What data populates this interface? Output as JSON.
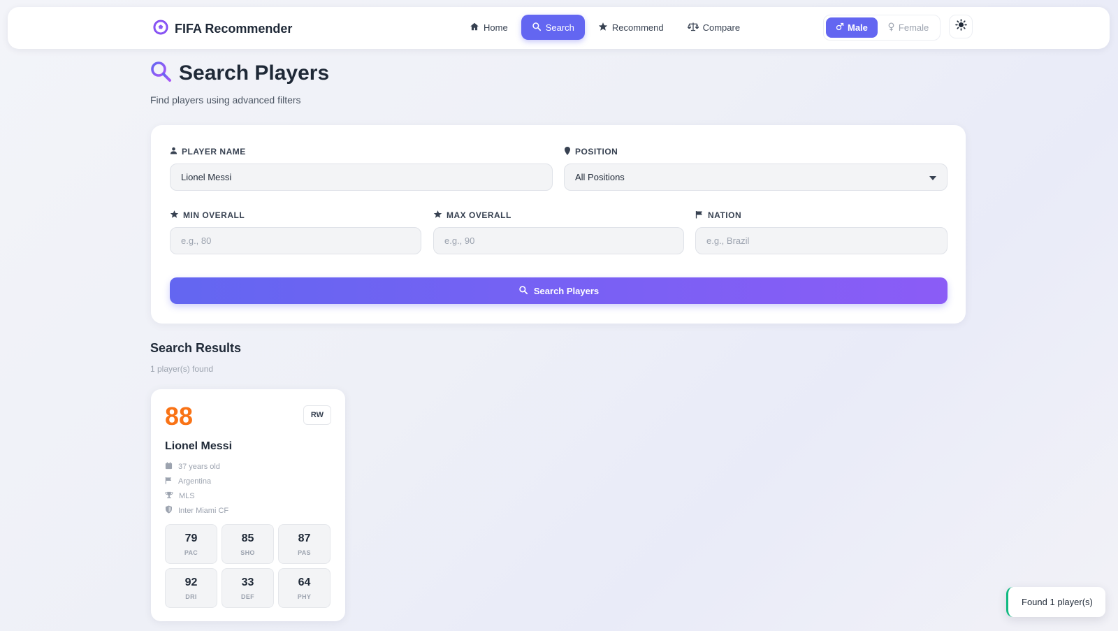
{
  "app": {
    "brand": "FIFA Recommender"
  },
  "nav": {
    "items": [
      {
        "label": "Home",
        "icon": "home-icon",
        "active": false
      },
      {
        "label": "Search",
        "icon": "search-icon",
        "active": true
      },
      {
        "label": "Recommend",
        "icon": "star-icon",
        "active": false
      },
      {
        "label": "Compare",
        "icon": "scale-icon",
        "active": false
      }
    ]
  },
  "gender": {
    "male": "Male",
    "female": "Female",
    "selected": "Male"
  },
  "header": {
    "title": "Search Players",
    "subtitle": "Find players using advanced filters"
  },
  "filters": {
    "player_name": {
      "label": "PLAYER NAME",
      "value": "Lionel Messi"
    },
    "position": {
      "label": "POSITION",
      "value": "All Positions"
    },
    "min_overall": {
      "label": "MIN OVERALL",
      "placeholder": "e.g., 80"
    },
    "max_overall": {
      "label": "MAX OVERALL",
      "placeholder": "e.g., 90"
    },
    "nation": {
      "label": "NATION",
      "placeholder": "e.g., Brazil"
    },
    "search_button": "Search Players"
  },
  "results": {
    "title": "Search Results",
    "count": "1 player(s) found",
    "players": [
      {
        "overall": "88",
        "position": "RW",
        "name": "Lionel Messi",
        "age": "37 years old",
        "nation": "Argentina",
        "league": "MLS",
        "club": "Inter Miami CF",
        "stats": [
          {
            "value": "79",
            "label": "PAC"
          },
          {
            "value": "85",
            "label": "SHO"
          },
          {
            "value": "87",
            "label": "PAS"
          },
          {
            "value": "92",
            "label": "DRI"
          },
          {
            "value": "33",
            "label": "DEF"
          },
          {
            "value": "64",
            "label": "PHY"
          }
        ]
      }
    ]
  },
  "toast": {
    "message": "Found 1 player(s)"
  },
  "colors": {
    "accent": "#6366f1",
    "accent_end": "#8b5cf6",
    "rating": "#f97316",
    "toast_border": "#10b981"
  }
}
